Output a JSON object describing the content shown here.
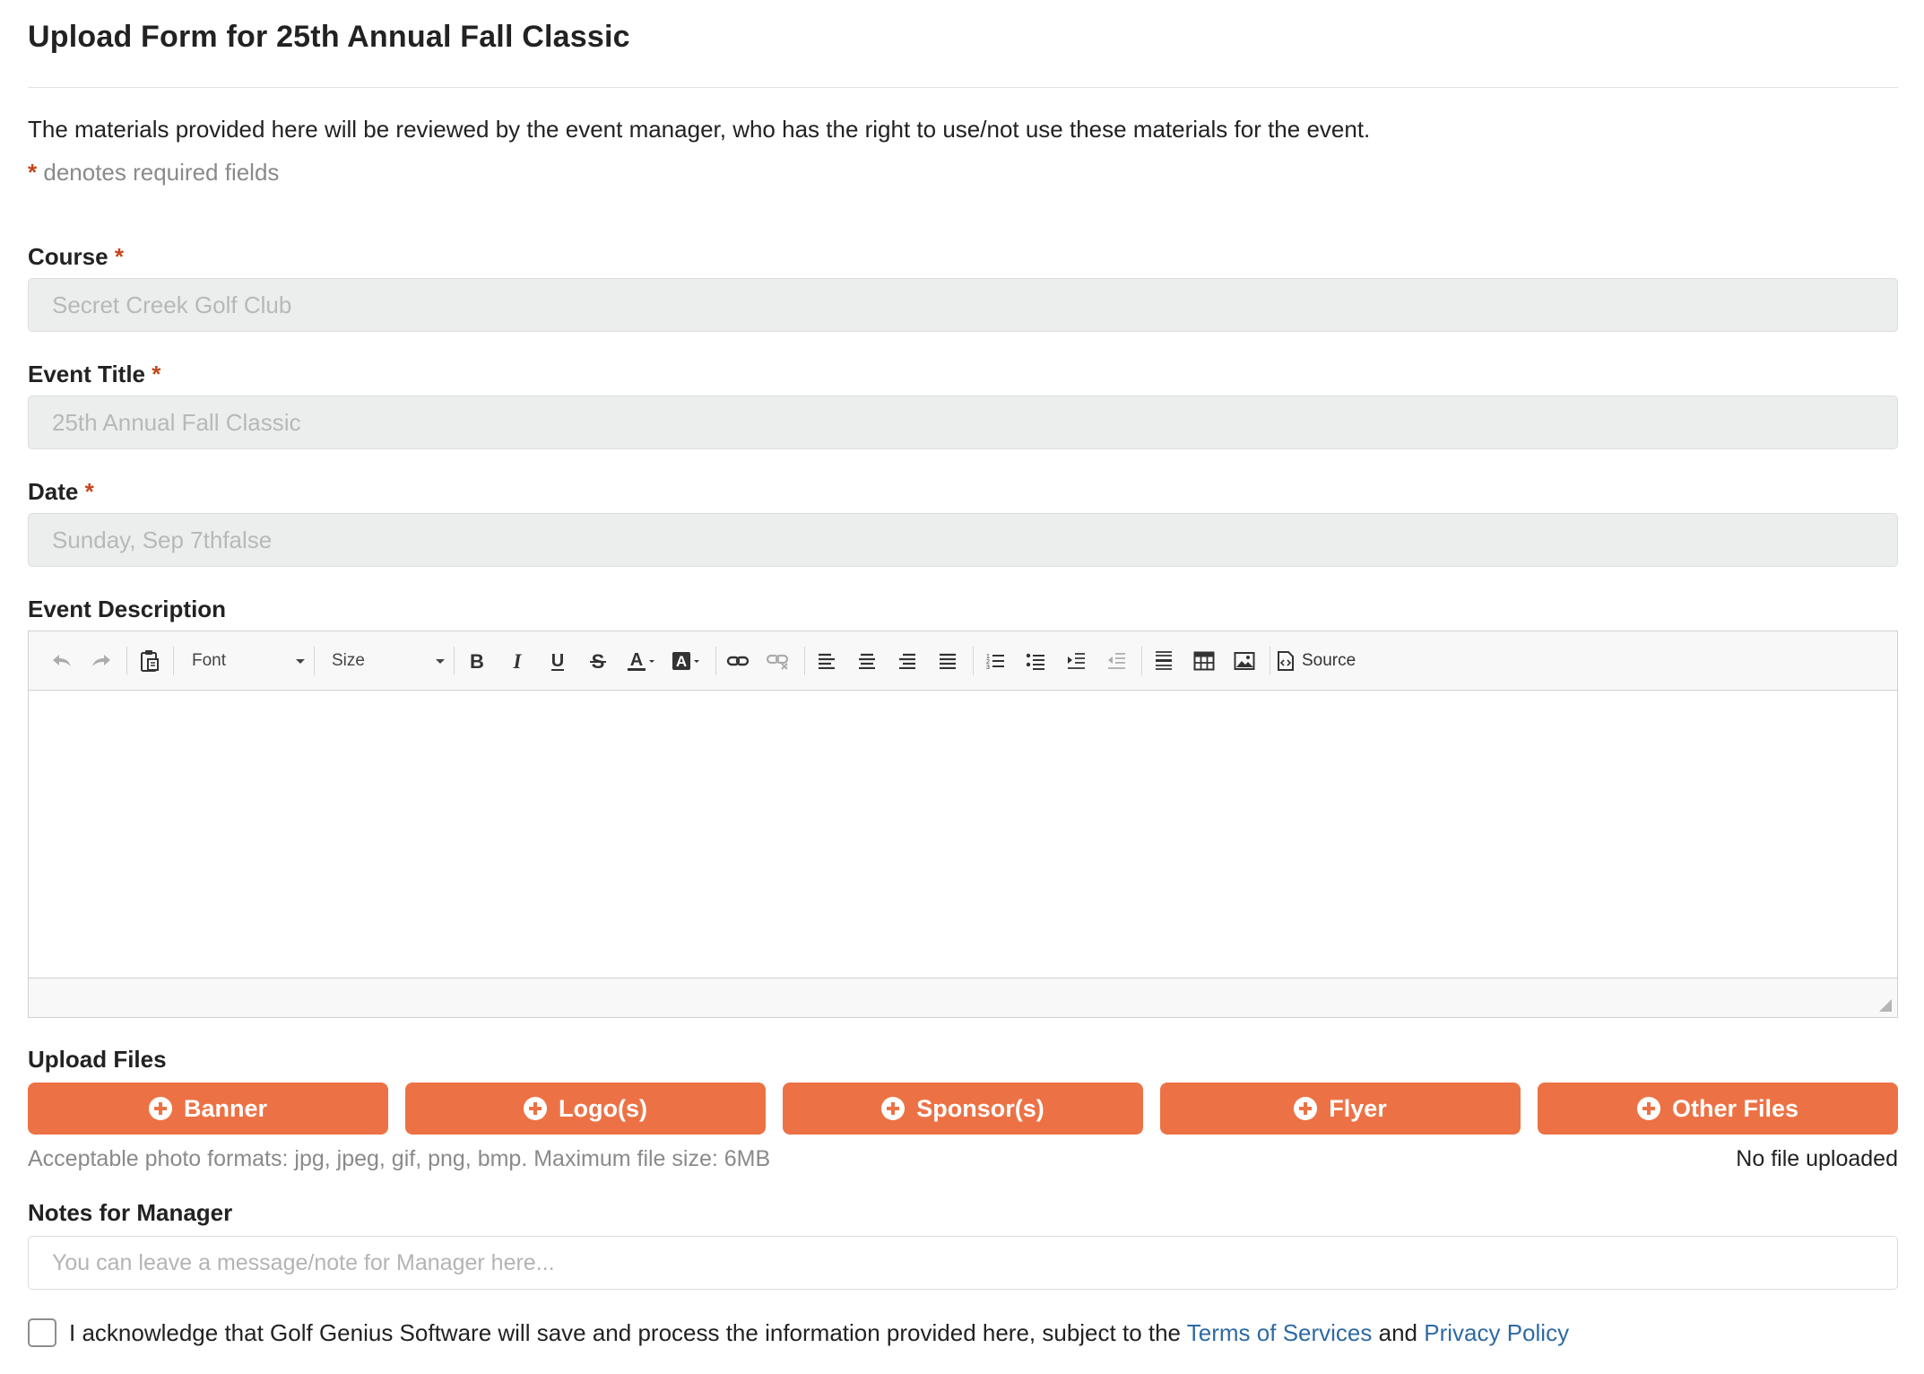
{
  "page": {
    "title": "Upload Form for 25th Annual Fall Classic",
    "intro": "The materials provided here will be reviewed by the event manager, who has the right to use/not use these materials for the event.",
    "required_star": "*",
    "required_note": "denotes required fields"
  },
  "fields": {
    "course": {
      "label": "Course",
      "value": "Secret Creek Golf Club"
    },
    "event_title": {
      "label": "Event Title",
      "value": "25th Annual Fall Classic"
    },
    "date": {
      "label": "Date",
      "value": "Sunday, Sep 7thfalse"
    }
  },
  "editor": {
    "label": "Event Description",
    "font_combo": "Font",
    "size_combo": "Size",
    "source_label": "Source",
    "content": ""
  },
  "upload": {
    "label": "Upload Files",
    "buttons": [
      "Banner",
      "Logo(s)",
      "Sponsor(s)",
      "Flyer",
      "Other Files"
    ],
    "formats_note": "Acceptable photo formats: jpg, jpeg, gif, png, bmp. Maximum file size: 6MB",
    "status": "No file uploaded"
  },
  "notes": {
    "label": "Notes for Manager",
    "placeholder": "You can leave a message/note for Manager here...",
    "value": ""
  },
  "acknowledge": {
    "checked": false,
    "text": "I acknowledge that Golf Genius Software will save and process the information provided here, subject to the",
    "terms_link": "Terms of Services",
    "and": "and",
    "privacy_link": "Privacy Policy"
  },
  "colors": {
    "accent_button": "#ec7245",
    "required_star": "#c4451e",
    "link": "#2e6aa3",
    "readonly_bg": "#eceeee"
  }
}
